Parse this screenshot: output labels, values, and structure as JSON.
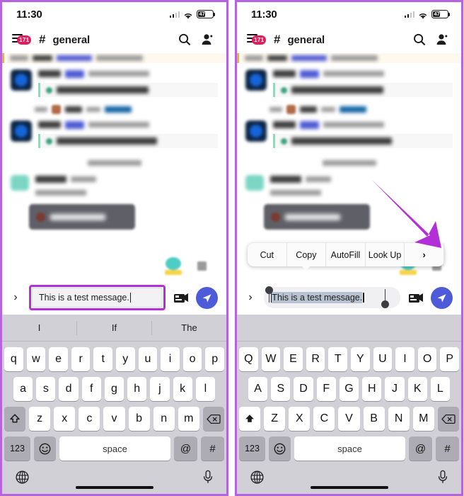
{
  "panels": [
    {
      "id": "left",
      "status": {
        "time": "11:30",
        "battery_level": "47"
      },
      "header": {
        "unread_badge": "171",
        "hash": "#",
        "channel": "general",
        "search_icon": "search-icon",
        "members_icon": "members-icon"
      },
      "composer": {
        "expand_icon": "chevron-right-icon",
        "text_value": "This is a test message.",
        "highlighted": true,
        "text_selected": false,
        "attach_icon": "attachment-icon",
        "send_icon": "send-icon"
      },
      "context_menu": null,
      "keyboard": {
        "suggestions": [
          "I",
          "If",
          "The"
        ],
        "row1": [
          "q",
          "w",
          "e",
          "r",
          "t",
          "y",
          "u",
          "i",
          "o",
          "p"
        ],
        "row2": [
          "a",
          "s",
          "d",
          "f",
          "g",
          "h",
          "j",
          "k",
          "l"
        ],
        "row3": [
          "z",
          "x",
          "c",
          "v",
          "b",
          "n",
          "m"
        ],
        "shift_label": "shift-key",
        "shift_active": false,
        "delete_label": "delete-key",
        "numbers_label": "123",
        "emoji_label": "emoji-key",
        "space_label": "space",
        "at_label": "@",
        "hash_label": "#",
        "globe_label": "globe-key",
        "mic_label": "microphone-key"
      }
    },
    {
      "id": "right",
      "status": {
        "time": "11:30",
        "battery_level": "47"
      },
      "header": {
        "unread_badge": "171",
        "hash": "#",
        "channel": "general",
        "search_icon": "search-icon",
        "members_icon": "members-icon"
      },
      "composer": {
        "expand_icon": "chevron-right-icon",
        "text_value": "This is a test message.",
        "highlighted": false,
        "text_selected": true,
        "attach_icon": "attachment-icon",
        "send_icon": "send-icon"
      },
      "context_menu": {
        "items": [
          "Cut",
          "Copy",
          "AutoFill",
          "Look Up"
        ],
        "more_label": "›"
      },
      "keyboard": {
        "suggestions": [
          "",
          "",
          ""
        ],
        "row1": [
          "Q",
          "W",
          "E",
          "R",
          "T",
          "Y",
          "U",
          "I",
          "O",
          "P"
        ],
        "row2": [
          "A",
          "S",
          "D",
          "F",
          "G",
          "H",
          "J",
          "K",
          "L"
        ],
        "row3": [
          "Z",
          "X",
          "C",
          "V",
          "B",
          "N",
          "M"
        ],
        "shift_label": "shift-key",
        "shift_active": true,
        "delete_label": "delete-key",
        "numbers_label": "123",
        "emoji_label": "emoji-key",
        "space_label": "space",
        "at_label": "@",
        "hash_label": "#",
        "globe_label": "globe-key",
        "mic_label": "microphone-key"
      }
    }
  ],
  "annotation": {
    "arrow_color": "#b32fd8",
    "points_at": "context-menu-more-chevron"
  },
  "colors": {
    "frame_border": "#b563de",
    "highlight": "#b32fd8",
    "send_button": "#4d5bd8",
    "badge_red": "#e01e5a",
    "keyboard_bg": "#d1d0d6",
    "key_special": "#adacb4",
    "selection": "#b9c2d0"
  }
}
